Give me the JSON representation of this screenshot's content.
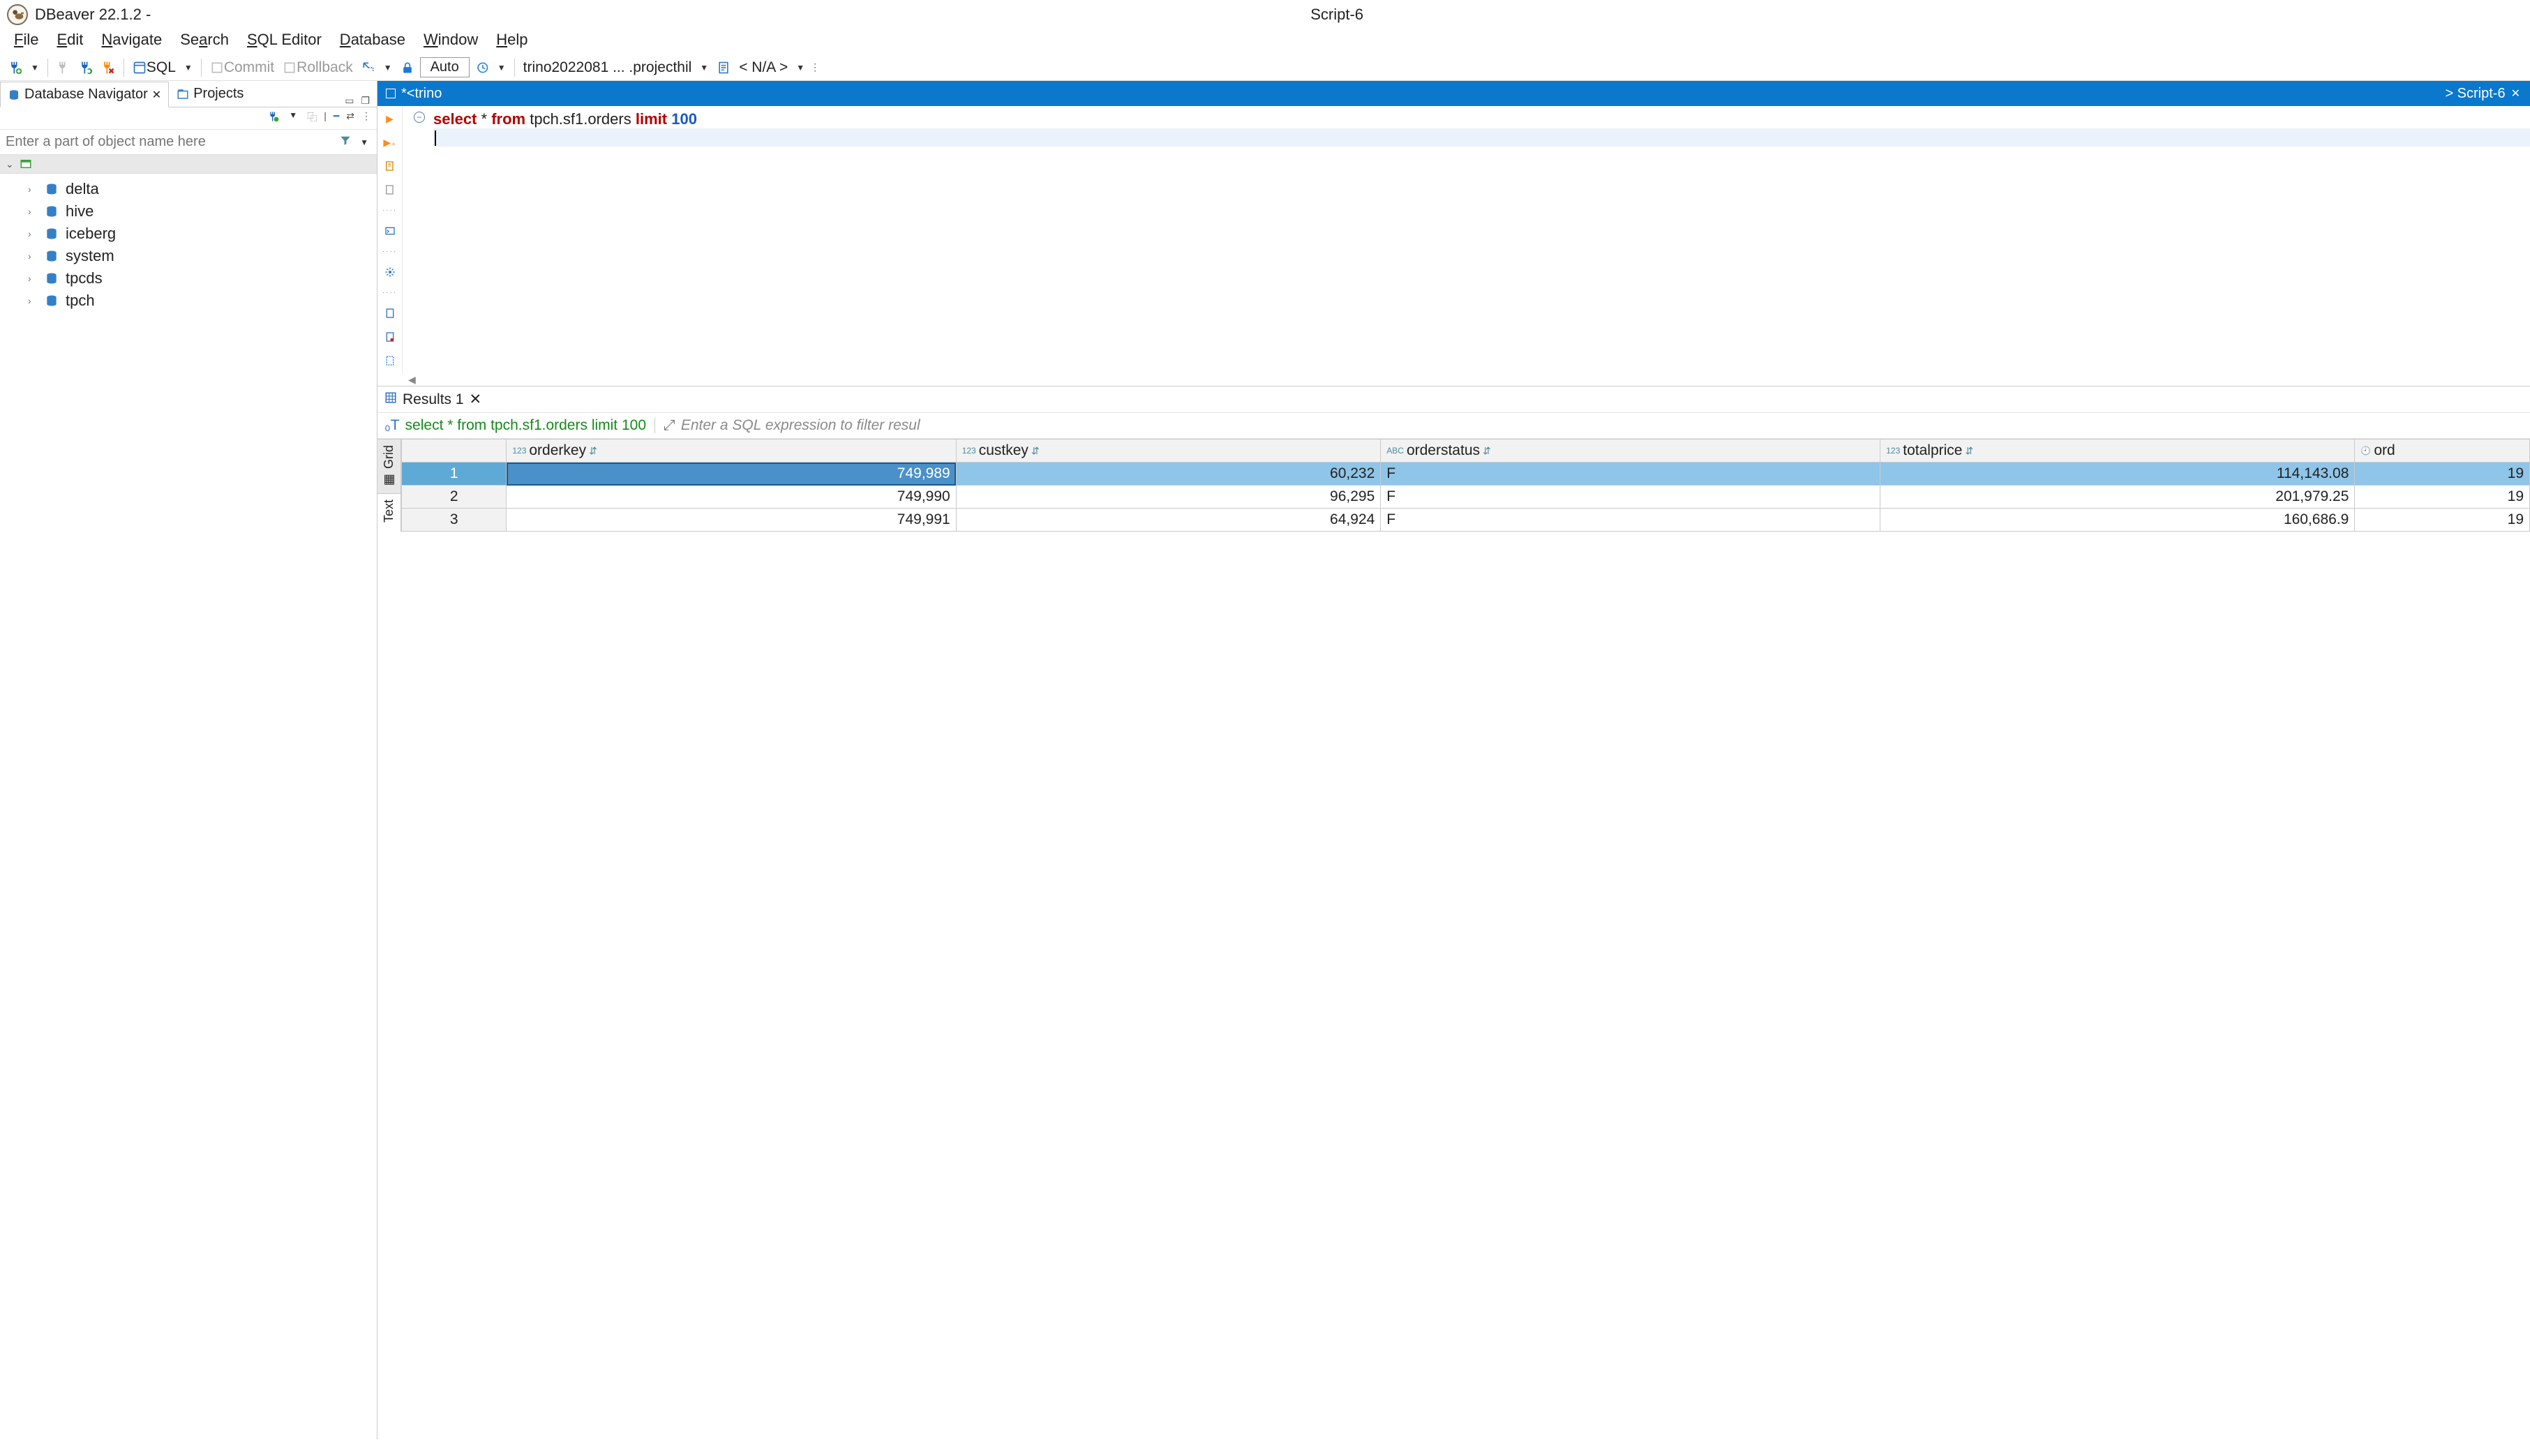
{
  "title": {
    "left": "DBeaver 22.1.2 -",
    "center": "Script-6"
  },
  "menu": [
    "File",
    "Edit",
    "Navigate",
    "Search",
    "SQL Editor",
    "Database",
    "Window",
    "Help"
  ],
  "toolbar": {
    "sql_label": "SQL",
    "commit_label": "Commit",
    "rollback_label": "Rollback",
    "auto_label": "Auto",
    "conn_label": "trino2022081 ... .projecthil",
    "schema_label": "< N/A >"
  },
  "navigator": {
    "tab_db": "Database Navigator",
    "tab_projects": "Projects",
    "filter_placeholder": "Enter a part of object name here",
    "catalogs": [
      "delta",
      "hive",
      "iceberg",
      "system",
      "tpcds",
      "tpch"
    ]
  },
  "editor": {
    "tab_left": "*<trino",
    "tab_right": "> Script-6",
    "sql_tokens": {
      "select": "select",
      "star": "*",
      "from": "from",
      "obj": "tpch.sf1.orders",
      "limit": "limit",
      "n": "100"
    }
  },
  "results": {
    "tab_label": "Results 1",
    "query_text": "select * from tpch.sf1.orders limit 100",
    "filter_placeholder": "Enter a SQL expression to filter resul",
    "side_tabs": [
      "Grid",
      "Text"
    ],
    "columns": [
      {
        "name": "orderkey",
        "type": "123"
      },
      {
        "name": "custkey",
        "type": "123"
      },
      {
        "name": "orderstatus",
        "type": "ABC"
      },
      {
        "name": "totalprice",
        "type": "123"
      },
      {
        "name": "ord",
        "type": "clock"
      }
    ],
    "rows": [
      {
        "n": 1,
        "orderkey": "749,989",
        "custkey": "60,232",
        "orderstatus": "F",
        "totalprice": "114,143.08",
        "ord": "19"
      },
      {
        "n": 2,
        "orderkey": "749,990",
        "custkey": "96,295",
        "orderstatus": "F",
        "totalprice": "201,979.25",
        "ord": "19"
      },
      {
        "n": 3,
        "orderkey": "749,991",
        "custkey": "64,924",
        "orderstatus": "F",
        "totalprice": "160,686.9",
        "ord": "19"
      }
    ]
  }
}
